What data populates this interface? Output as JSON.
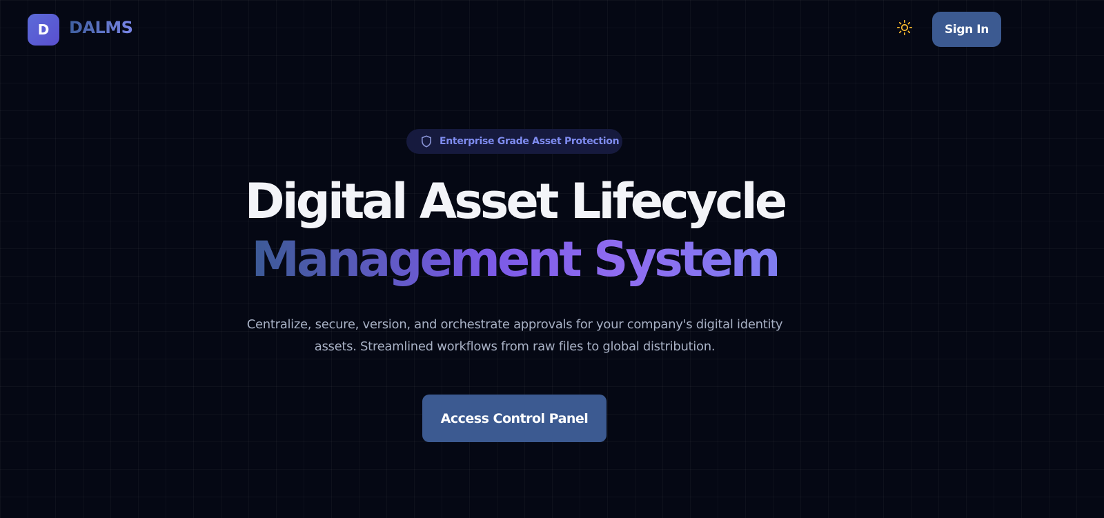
{
  "header": {
    "logo_letter": "D",
    "brand_name": "DALMS",
    "theme_toggle_icon": "sun-icon",
    "signin_label": "Sign In"
  },
  "hero": {
    "badge_icon": "shield-icon",
    "badge_text": "Enterprise Grade Asset Protection",
    "title_line1": "Digital Asset Lifecycle",
    "title_line2": "Management System",
    "subtitle": "Centralize, secure, version, and orchestrate approvals for your company's digital identity assets. Streamlined workflows from raw files to global distribution.",
    "cta_label": "Access Control Panel"
  },
  "colors": {
    "background": "#050814",
    "primary_button": "#3c5a91",
    "accent_indigo": "#7f8cf0",
    "accent_purple": "#8f6cf0",
    "sun_icon": "#f5b82e"
  }
}
